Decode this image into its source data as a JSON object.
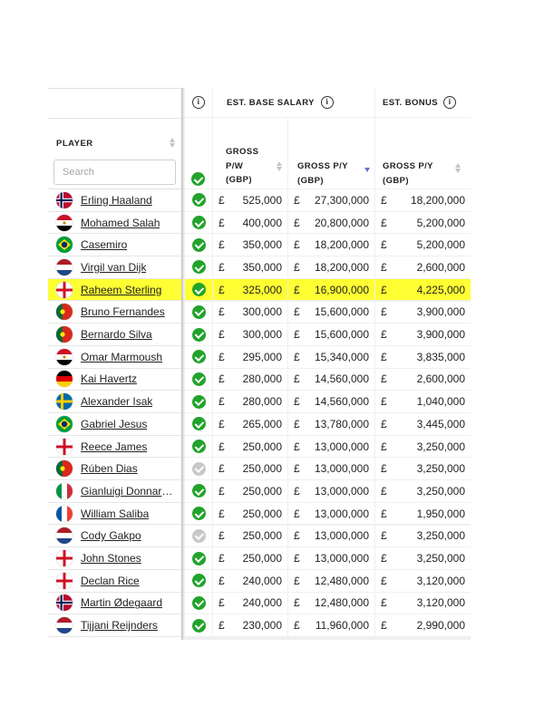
{
  "header": {
    "est_base_salary": "EST. BASE SALARY",
    "est_bonus": "EST. BONUS",
    "info_glyph": "i",
    "player_label": "PLAYER",
    "gross_pw": "GROSS P/W (GBP)",
    "gross_py": "GROSS P/Y (GBP)",
    "bonus_gross_py": "GROSS P/Y (GBP)",
    "sorted_column": "base_py",
    "sort_direction": "descending"
  },
  "search": {
    "placeholder": "Search",
    "value": ""
  },
  "currency_symbol": "£",
  "highlight_color": "#ffff33",
  "colors": {
    "verified": "#22a32b",
    "unverified": "#c8c8c8",
    "sort_active": "#6b73c7"
  },
  "players": [
    {
      "name": "Erling Haaland",
      "flag": "norway-flag-icon",
      "verified": true,
      "pw": "525,000",
      "py": "27,300,000",
      "bonus": "18,200,000"
    },
    {
      "name": "Mohamed Salah",
      "flag": "egypt-flag-icon",
      "verified": true,
      "pw": "400,000",
      "py": "20,800,000",
      "bonus": "5,200,000"
    },
    {
      "name": "Casemiro",
      "flag": "brazil-flag-icon",
      "verified": true,
      "pw": "350,000",
      "py": "18,200,000",
      "bonus": "5,200,000"
    },
    {
      "name": "Virgil van Dijk",
      "flag": "netherlands-flag-icon",
      "verified": true,
      "pw": "350,000",
      "py": "18,200,000",
      "bonus": "2,600,000"
    },
    {
      "name": "Raheem Sterling",
      "flag": "england-flag-icon",
      "verified": true,
      "pw": "325,000",
      "py": "16,900,000",
      "bonus": "4,225,000",
      "highlighted": true
    },
    {
      "name": "Bruno Fernandes",
      "flag": "portugal-flag-icon",
      "verified": true,
      "pw": "300,000",
      "py": "15,600,000",
      "bonus": "3,900,000"
    },
    {
      "name": "Bernardo Silva",
      "flag": "portugal-flag-icon",
      "verified": true,
      "pw": "300,000",
      "py": "15,600,000",
      "bonus": "3,900,000"
    },
    {
      "name": "Omar Marmoush",
      "flag": "egypt-flag-icon",
      "verified": true,
      "pw": "295,000",
      "py": "15,340,000",
      "bonus": "3,835,000"
    },
    {
      "name": "Kai Havertz",
      "flag": "germany-flag-icon",
      "verified": true,
      "pw": "280,000",
      "py": "14,560,000",
      "bonus": "2,600,000"
    },
    {
      "name": "Alexander Isak",
      "flag": "sweden-flag-icon",
      "verified": true,
      "pw": "280,000",
      "py": "14,560,000",
      "bonus": "1,040,000"
    },
    {
      "name": "Gabriel Jesus",
      "flag": "brazil-flag-icon",
      "verified": true,
      "pw": "265,000",
      "py": "13,780,000",
      "bonus": "3,445,000"
    },
    {
      "name": "Reece James",
      "flag": "england-flag-icon",
      "verified": true,
      "pw": "250,000",
      "py": "13,000,000",
      "bonus": "3,250,000"
    },
    {
      "name": "Rúben Dias",
      "flag": "portugal-flag-icon",
      "verified": false,
      "pw": "250,000",
      "py": "13,000,000",
      "bonus": "3,250,000"
    },
    {
      "name": "Gianluigi Donnarumma",
      "flag": "italy-flag-icon",
      "verified": true,
      "pw": "250,000",
      "py": "13,000,000",
      "bonus": "3,250,000"
    },
    {
      "name": "William Saliba",
      "flag": "france-flag-icon",
      "verified": true,
      "pw": "250,000",
      "py": "13,000,000",
      "bonus": "1,950,000"
    },
    {
      "name": "Cody Gakpo",
      "flag": "netherlands-flag-icon",
      "verified": false,
      "pw": "250,000",
      "py": "13,000,000",
      "bonus": "3,250,000"
    },
    {
      "name": "John Stones",
      "flag": "england-flag-icon",
      "verified": true,
      "pw": "250,000",
      "py": "13,000,000",
      "bonus": "3,250,000"
    },
    {
      "name": "Declan Rice",
      "flag": "england-flag-icon",
      "verified": true,
      "pw": "240,000",
      "py": "12,480,000",
      "bonus": "3,120,000"
    },
    {
      "name": "Martin Ødegaard",
      "flag": "norway-flag-icon",
      "verified": true,
      "pw": "240,000",
      "py": "12,480,000",
      "bonus": "3,120,000"
    },
    {
      "name": "Tijjani Reijnders",
      "flag": "netherlands-flag-icon",
      "verified": true,
      "pw": "230,000",
      "py": "11,960,000",
      "bonus": "2,990,000"
    }
  ]
}
